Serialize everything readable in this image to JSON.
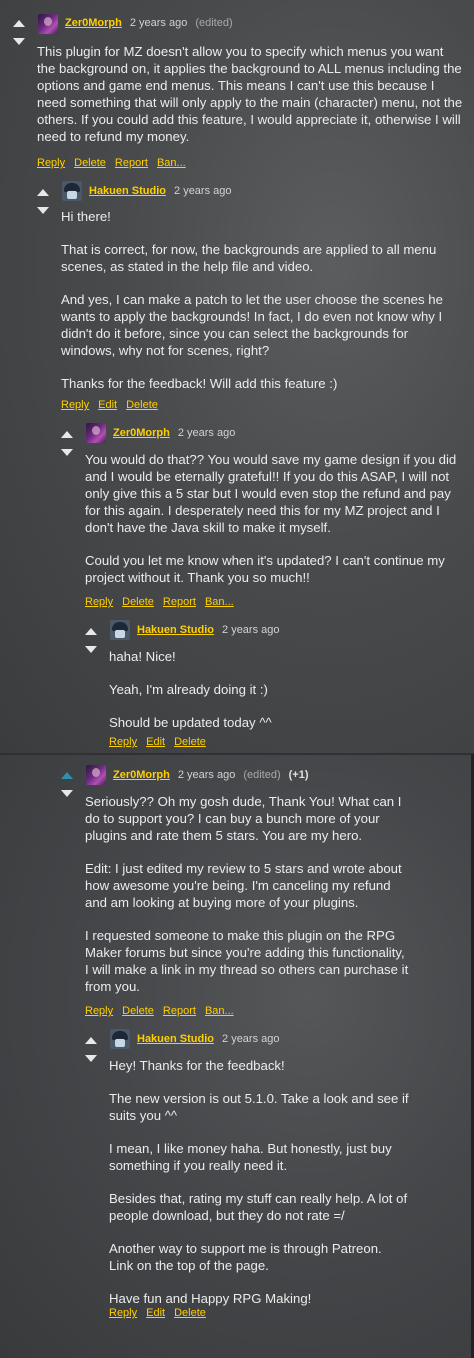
{
  "comments": [
    {
      "author": "Zer0Morph",
      "time": "2 years ago",
      "edited": "(edited)",
      "paragraphs": [
        "This plugin for MZ doesn't allow you to specify which menus you want the background on, it applies the background to ALL menus including the options and game end menus. This means I can't use this because I need something that will only apply to the main (character) menu, not the others. If you could add this feature, I would appreciate it, otherwise I will need to refund my money."
      ],
      "actions": [
        "Reply",
        "Delete",
        "Report",
        "Ban..."
      ]
    },
    {
      "author": "Hakuen Studio",
      "time": "2 years ago",
      "paragraphs": [
        "Hi there!",
        "That is correct, for now, the backgrounds are applied to all menu scenes, as stated in the help file and video.",
        "And yes, I can make a patch to let the user choose the scenes he wants to apply the backgrounds! In fact, I do even not know why I didn't do it before, since you can select the backgrounds for windows, why not for scenes, right?",
        "Thanks for the feedback! Will add this feature :)"
      ],
      "actions": [
        "Reply",
        "Edit",
        "Delete"
      ]
    },
    {
      "author": "Zer0Morph",
      "time": "2 years ago",
      "paragraphs": [
        "You would do that?? You would save my game design if you did and I would be eternally grateful!! If you do this ASAP, I will not only give this a 5 star but I would even stop the refund and pay for this again. I desperately need this for my MZ project and I don't have the Java skill to make it myself.",
        "Could you let me know when it's updated? I can't continue my project without it. Thank you so much!!"
      ],
      "actions": [
        "Reply",
        "Delete",
        "Report",
        "Ban..."
      ]
    },
    {
      "author": "Hakuen Studio",
      "time": "2 years ago",
      "paragraphs": [
        "haha! Nice!",
        "Yeah, I'm already doing it :)",
        "Should be updated today ^^"
      ],
      "actions": [
        "Reply",
        "Edit",
        "Delete"
      ]
    },
    {
      "author": "Zer0Morph",
      "time": "2 years ago",
      "edited": "(edited)",
      "score": "(+1)",
      "upvoted": true,
      "paragraphs": [
        "Seriously?? Oh my gosh dude, Thank You! What can I do to support you? I can buy a bunch more of your plugins and rate them 5 stars. You are my hero.",
        "Edit: I just edited my review to 5 stars and wrote about how awesome you're being. I'm canceling my refund and am looking at buying more of your plugins.",
        "I requested someone to make this plugin on the RPG Maker forums but since you're adding this functionality, I will make a link in my thread so others can purchase it from you."
      ],
      "actions": [
        "Reply",
        "Delete",
        "Report",
        "Ban..."
      ]
    },
    {
      "author": "Hakuen Studio",
      "time": "2 years ago",
      "paragraphs": [
        "Hey! Thanks for the feedback!",
        "The new version is out 5.1.0. Take a look and see if suits you ^^",
        "I mean, I like money haha. But honestly, just buy something if you really need it.",
        "Besides that, rating my stuff can really help. A lot of people download, but they do not rate =/",
        "Another way to support me is through Patreon. Link on the top of the page.",
        "Have fun and Happy RPG Making!"
      ],
      "actions": [
        "Reply",
        "Edit",
        "Delete"
      ]
    }
  ]
}
